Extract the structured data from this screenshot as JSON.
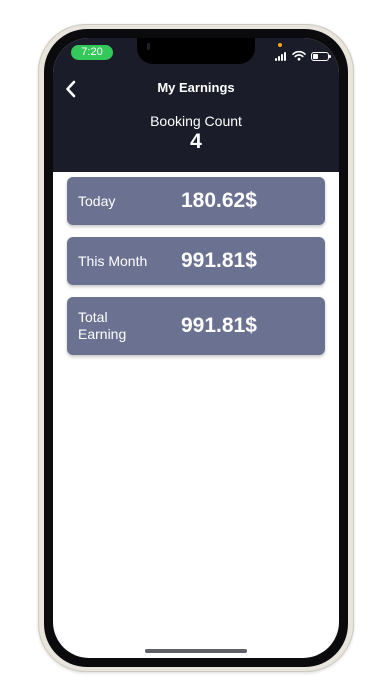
{
  "status_bar": {
    "time": "7:20",
    "time_pill_color": "#34c759",
    "icons": [
      "signal-icon",
      "wifi-icon",
      "battery-icon"
    ]
  },
  "nav": {
    "title": "My Earnings",
    "back_icon": "chevron-left-icon"
  },
  "booking": {
    "label": "Booking Count",
    "count": "4"
  },
  "earnings": [
    {
      "label": "Today",
      "value": "180.62$"
    },
    {
      "label": "This Month",
      "value": "991.81$"
    },
    {
      "label": "Total Earning",
      "value": "991.81$"
    }
  ],
  "colors": {
    "header_bg": "#1b1c2a",
    "card_bg": "#6b7191",
    "screen_bg": "#ffffff"
  }
}
